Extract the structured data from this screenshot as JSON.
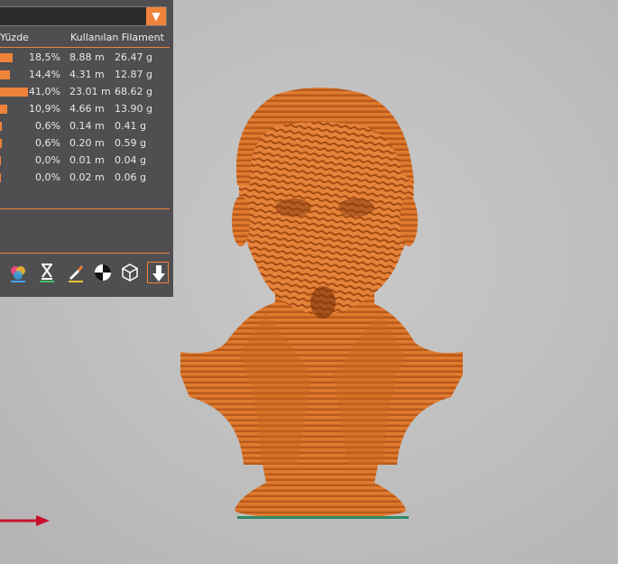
{
  "panel": {
    "columns": {
      "percent": "Yüzde",
      "used_filament": "Kullanılan Filament"
    },
    "rows": [
      {
        "percent": "18,5%",
        "length": "8.88 m",
        "weight": "26.47 g",
        "share": 0.185
      },
      {
        "percent": "14,4%",
        "length": "4.31 m",
        "weight": "12.87 g",
        "share": 0.144
      },
      {
        "percent": "41,0%",
        "length": "23.01 m",
        "weight": "68.62 g",
        "share": 0.41
      },
      {
        "percent": "10,9%",
        "length": "4.66 m",
        "weight": "13.90 g",
        "share": 0.109
      },
      {
        "percent": "0,6%",
        "length": "0.14 m",
        "weight": "0.41 g",
        "share": 0.006
      },
      {
        "percent": "0,6%",
        "length": "0.20 m",
        "weight": "0.59 g",
        "share": 0.006
      },
      {
        "percent": "0,0%",
        "length": "0.01 m",
        "weight": "0.04 g",
        "share": 0.0
      },
      {
        "percent": "0,0%",
        "length": "0.02 m",
        "weight": "0.06 g",
        "share": 0.0
      }
    ]
  },
  "toolbar": {
    "icons": [
      "color-print-icon",
      "hourglass-icon",
      "paint-brush-icon",
      "half-circle-icon",
      "wireframe-cube-icon",
      "export-icon"
    ]
  },
  "colors": {
    "accent": "#f0833a",
    "panel_bg": "#4f4f51",
    "viewport_bg": "#bfbfbf",
    "model": "#e07a2e",
    "axis_x": "#c8102e",
    "bed_plate": "#2e8a66"
  }
}
